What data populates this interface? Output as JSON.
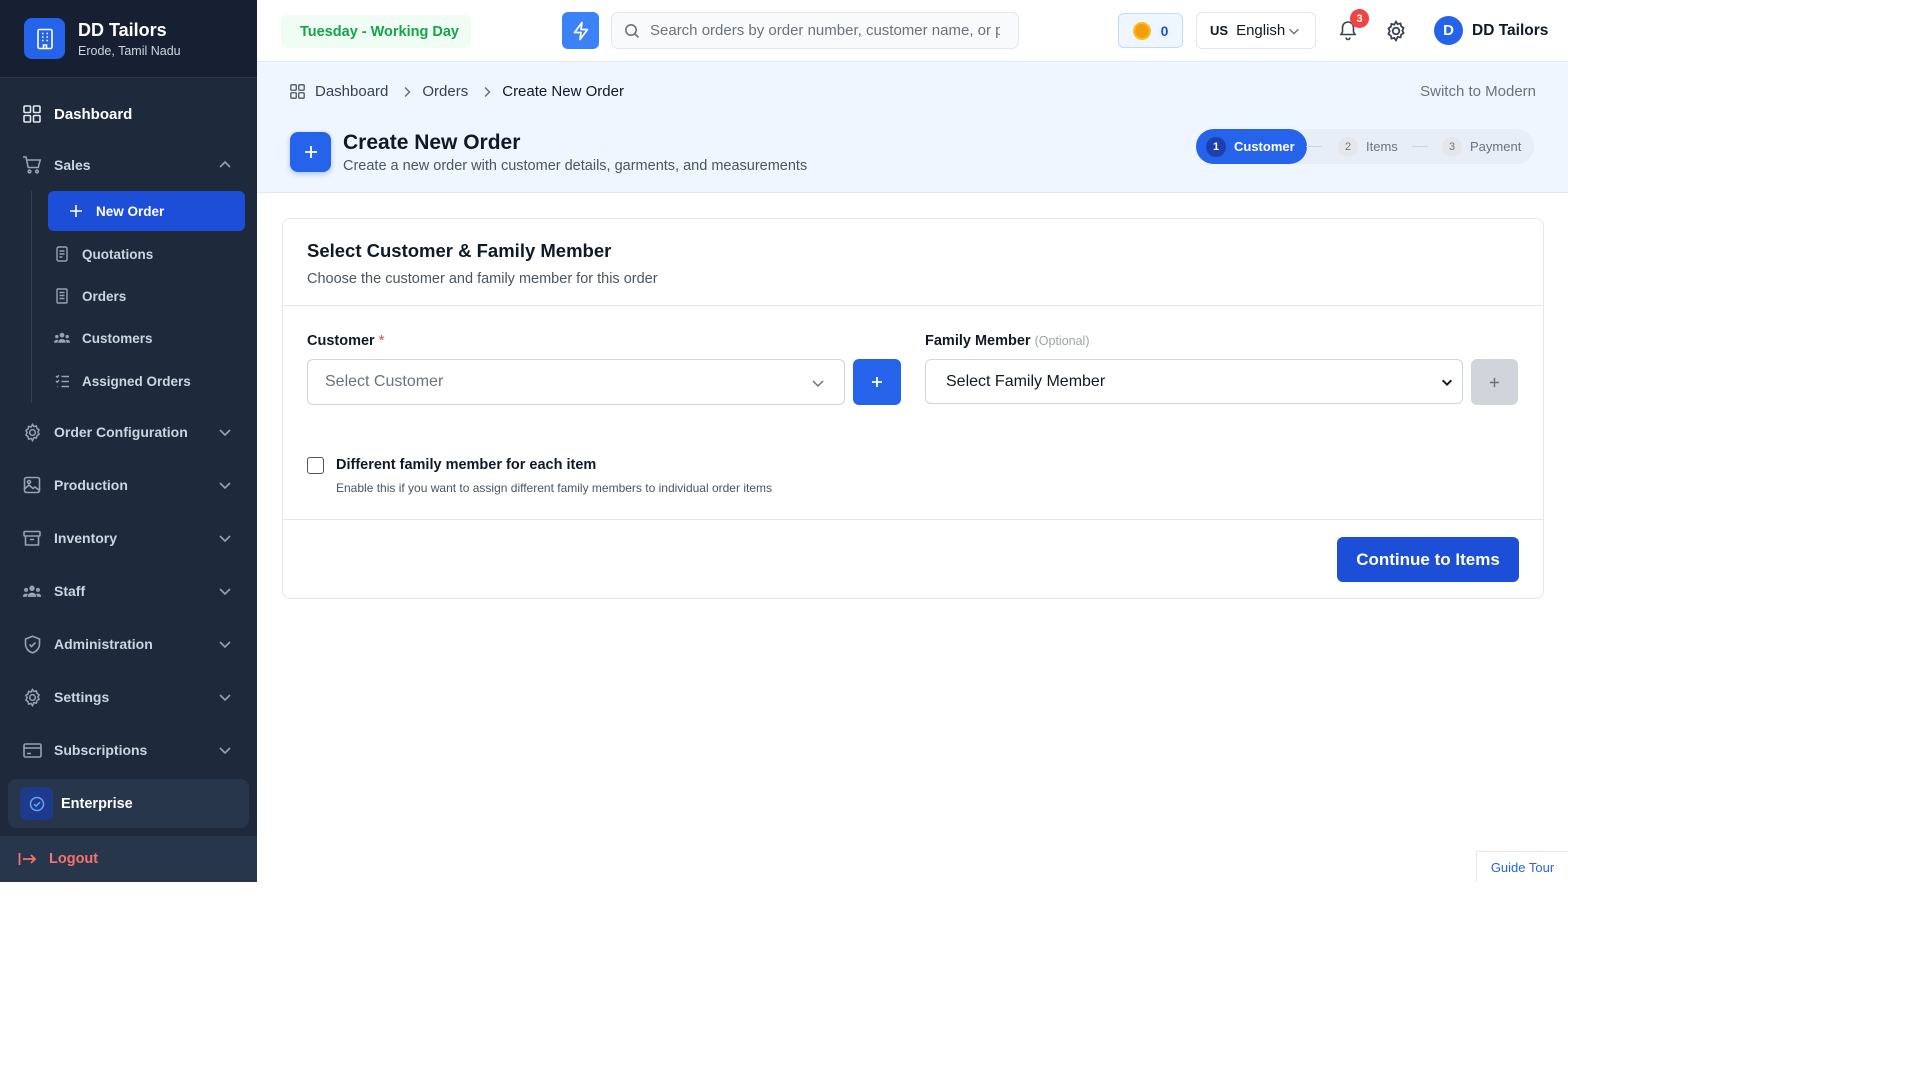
{
  "brand": {
    "name": "DD Tailors",
    "location": "Erode, Tamil Nadu"
  },
  "sidebar": {
    "dashboard": "Dashboard",
    "sales": "Sales",
    "sales_items": [
      "New Order",
      "Quotations",
      "Orders",
      "Customers",
      "Assigned Orders"
    ],
    "groups": [
      "Order Configuration",
      "Production",
      "Inventory",
      "Staff",
      "Administration",
      "Settings",
      "Subscriptions"
    ],
    "plan": "Enterprise",
    "logout": "Logout"
  },
  "topbar": {
    "day_status": "Tuesday - Working Day",
    "search_placeholder": "Search orders by order number, customer name, or phone",
    "coins": "0",
    "language_flag": "US",
    "language": "English",
    "notification_count": "3",
    "user_initial": "D",
    "user_name": "DD Tailors"
  },
  "breadcrumb": [
    "Dashboard",
    "Orders",
    "Create New Order"
  ],
  "switch_modern": "Switch to Modern",
  "page": {
    "title": "Create New Order",
    "subtitle": "Create a new order with customer details, garments, and measurements"
  },
  "steps": [
    {
      "num": "1",
      "label": "Customer"
    },
    {
      "num": "2",
      "label": "Items"
    },
    {
      "num": "3",
      "label": "Payment"
    }
  ],
  "card": {
    "title": "Select Customer & Family Member",
    "subtitle": "Choose the customer and family member for this order",
    "customer_label": "Customer",
    "required_mark": "*",
    "customer_placeholder": "Select Customer",
    "family_label": "Family Member",
    "family_optional": "(Optional)",
    "family_value": "Select Family Member",
    "checkbox_label": "Different family member for each item",
    "checkbox_help": "Enable this if you want to assign different family members to individual order items",
    "continue": "Continue to Items"
  },
  "guide_tour": "Guide Tour",
  "colors": {
    "primary": "#2563eb",
    "sidebar": "#1e293b",
    "success": "#16a34a",
    "danger": "#ef4444"
  }
}
